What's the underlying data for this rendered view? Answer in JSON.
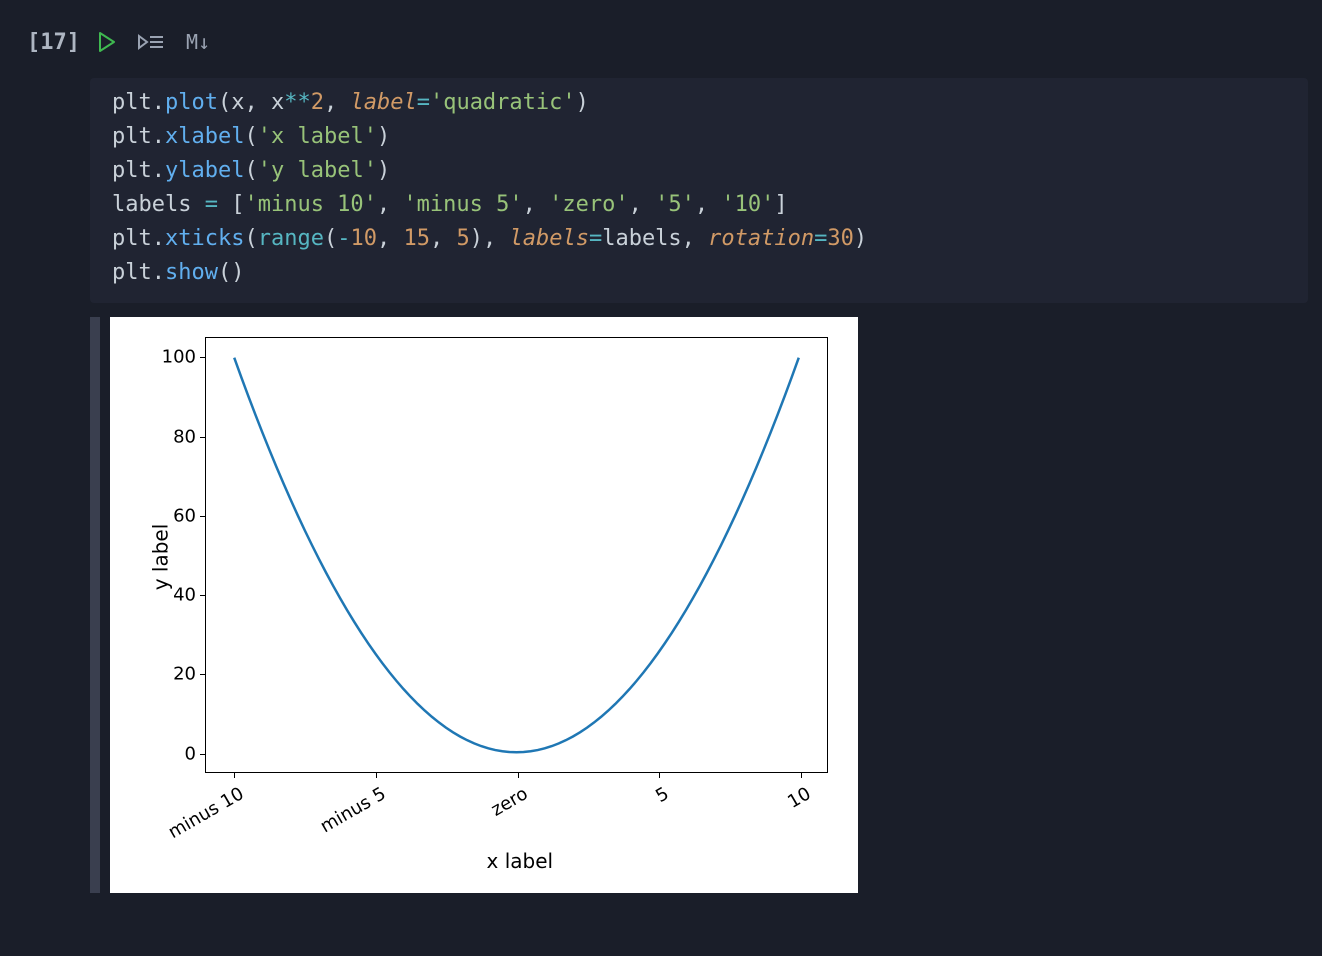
{
  "cell": {
    "prompt": "[17]",
    "toolbar": {
      "run_name": "run-cell",
      "run_by_line_name": "run-by-line",
      "markdown_label": "M↓"
    },
    "code": {
      "line1": {
        "a": "plt",
        "b": ".",
        "c": "plot",
        "d": "(x, x",
        "e": "**",
        "f": "2",
        "g": ", ",
        "h": "label",
        "i": "=",
        "j": "'quadratic'",
        "k": ")"
      },
      "line2": {
        "a": "plt",
        "b": ".",
        "c": "xlabel",
        "d": "(",
        "e": "'x label'",
        "f": ")"
      },
      "line3": {
        "a": "plt",
        "b": ".",
        "c": "ylabel",
        "d": "(",
        "e": "'y label'",
        "f": ")"
      },
      "line4": {
        "a": "labels ",
        "b": "=",
        "c": " [",
        "d": "'minus 10'",
        "e": ", ",
        "f": "'minus 5'",
        "g": ", ",
        "h": "'zero'",
        "i": ", ",
        "j": "'5'",
        "k": ", ",
        "l": "'10'",
        "m": "]"
      },
      "line5": {
        "a": "plt",
        "b": ".",
        "c": "xticks",
        "d": "(",
        "e": "range",
        "f": "(",
        "g": "-",
        "h": "10",
        "i": ", ",
        "j": "15",
        "k": ", ",
        "l": "5",
        "m": "), ",
        "n": "labels",
        "o": "=",
        "p": "labels, ",
        "q": "rotation",
        "r": "=",
        "s": "30",
        "t": ")"
      },
      "line6": {
        "a": "plt",
        "b": ".",
        "c": "show",
        "d": "()"
      }
    }
  },
  "chart_data": {
    "type": "line",
    "series": [
      {
        "name": "quadratic",
        "x": [
          -10,
          -9,
          -8,
          -7,
          -6,
          -5,
          -4,
          -3,
          -2,
          -1,
          0,
          1,
          2,
          3,
          4,
          5,
          6,
          7,
          8,
          9,
          10
        ],
        "y": [
          100,
          81,
          64,
          49,
          36,
          25,
          16,
          9,
          4,
          1,
          0,
          1,
          4,
          9,
          16,
          25,
          36,
          49,
          64,
          81,
          100
        ]
      }
    ],
    "xlabel": "x label",
    "ylabel": "y label",
    "xticks": {
      "positions": [
        -10,
        -5,
        0,
        5,
        10
      ],
      "labels": [
        "minus 10",
        "minus 5",
        "zero",
        "5",
        "10"
      ],
      "rotation": 30
    },
    "yticks": {
      "positions": [
        0,
        20,
        40,
        60,
        80,
        100
      ],
      "labels": [
        "0",
        "20",
        "40",
        "60",
        "80",
        "100"
      ]
    },
    "xlim": [
      -11,
      11
    ],
    "ylim": [
      -5,
      105
    ]
  }
}
